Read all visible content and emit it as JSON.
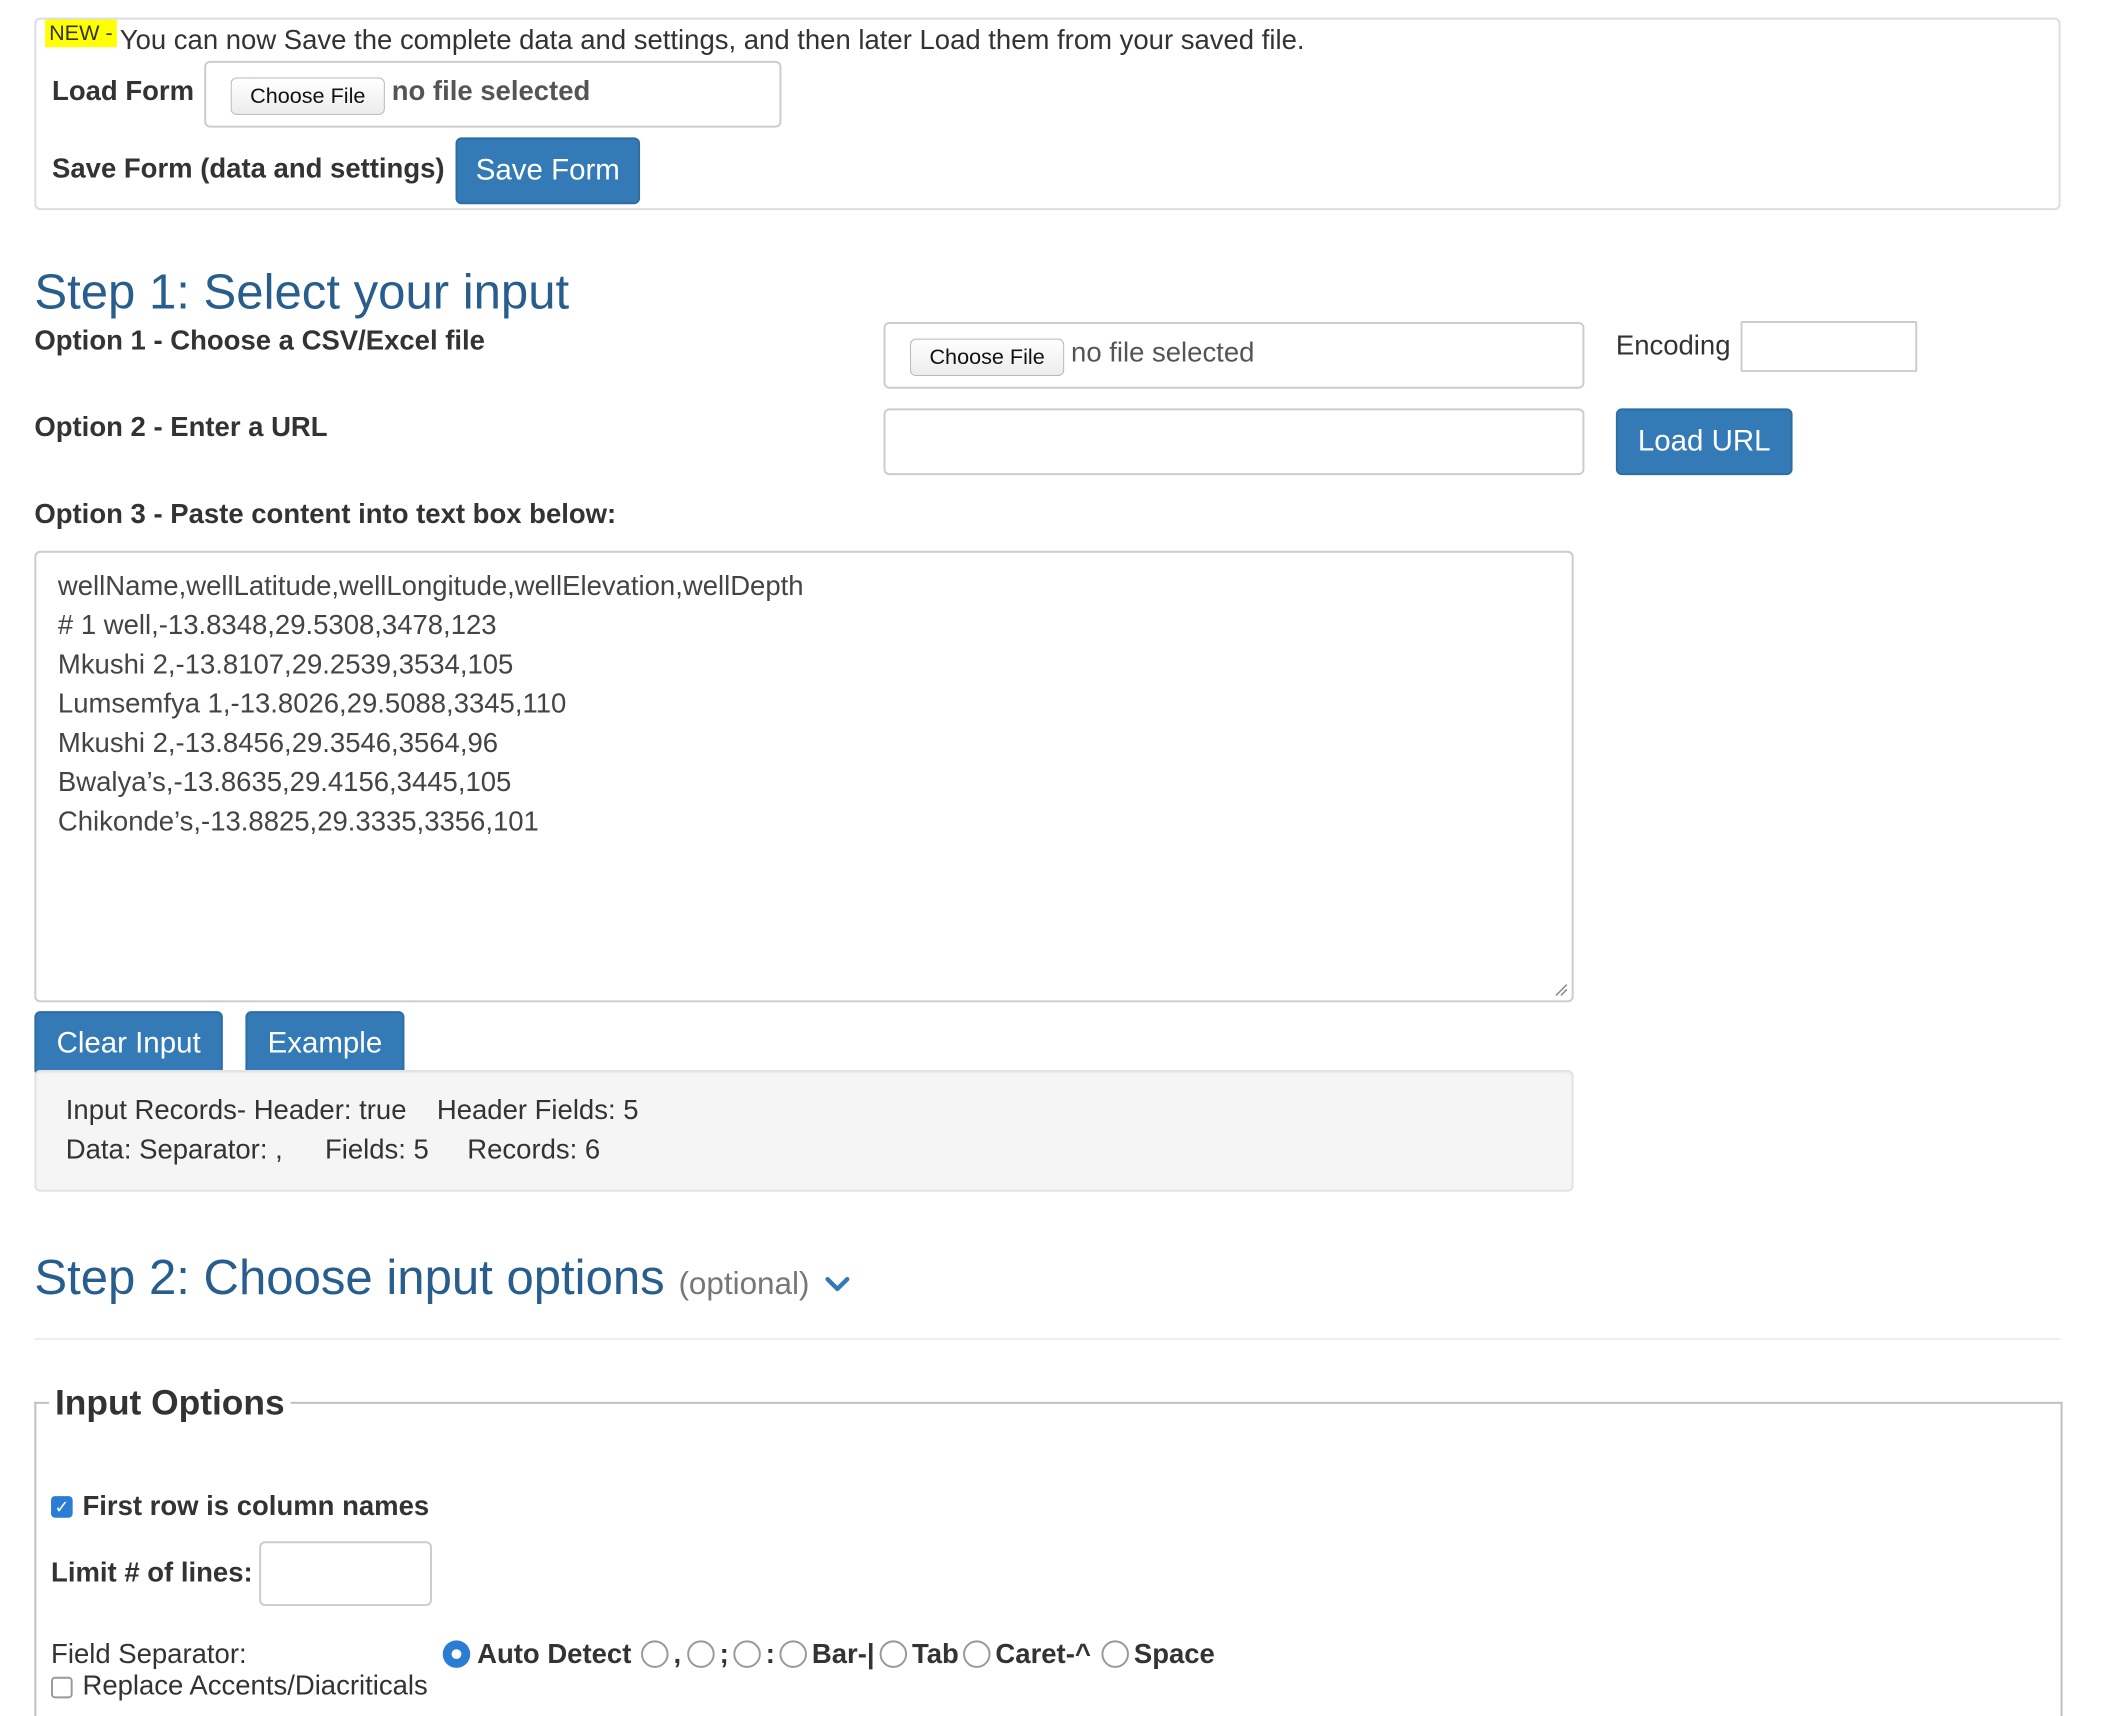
{
  "save_load": {
    "badge": "NEW -",
    "notice": "You can now Save the complete data and settings, and then later Load them from your saved file.",
    "load_label": "Load Form",
    "choose_file": "Choose File",
    "no_file": "no file selected",
    "save_label": "Save Form (data and settings)",
    "save_button": "Save Form"
  },
  "step1": {
    "title": "Step 1: Select your input",
    "option1": "Option 1 - Choose a CSV/Excel file",
    "choose_file": "Choose File",
    "no_file": "no file selected",
    "encoding_label": "Encoding",
    "encoding_value": "",
    "option2": "Option 2 - Enter a URL",
    "url_value": "",
    "load_url": "Load URL",
    "option3": "Option 3 - Paste content into text box below:",
    "textarea_lines": [
      "wellName,wellLatitude,wellLongitude,wellElevation,wellDepth",
      "# 1 well,-13.8348,29.5308,3478,123",
      "Mkushi 2,-13.8107,29.2539,3534,105",
      "Lumsemfya 1,-13.8026,29.5088,3345,110",
      "Mkushi 2,-13.8456,29.3546,3564,96",
      "Bwalya’s,-13.8635,29.4156,3445,105",
      "Chikonde’s,-13.8825,29.3335,3356,101"
    ],
    "clear_button": "Clear Input",
    "example_button": "Example",
    "stats": {
      "line1_a": "Input Records- Header: true",
      "line1_b": "Header Fields: 5",
      "line2_a": "Data: Separator: ,",
      "line2_b": "Fields: 5",
      "line2_c": "Records: 6"
    }
  },
  "step2": {
    "title": "Step 2: Choose input options",
    "optional": "(optional)",
    "chevron_icon": "chevron-down-icon",
    "legend": "Input Options",
    "first_row_label": "First row is column names",
    "first_row_checked": true,
    "limit_label": "Limit # of lines:",
    "limit_value": "",
    "separator_label": "Field Separator:",
    "separator_options": [
      "Auto Detect",
      ",",
      ";",
      ":",
      "Bar-|",
      "Tab",
      "Caret-^",
      "Space"
    ],
    "separator_selected": "Auto Detect",
    "replace_label": "Replace Accents/Diacriticals"
  },
  "colors": {
    "primary": "#337ab7",
    "heading": "#285e8e",
    "badge": "#ffff00",
    "checked": "#2b7cd3"
  }
}
